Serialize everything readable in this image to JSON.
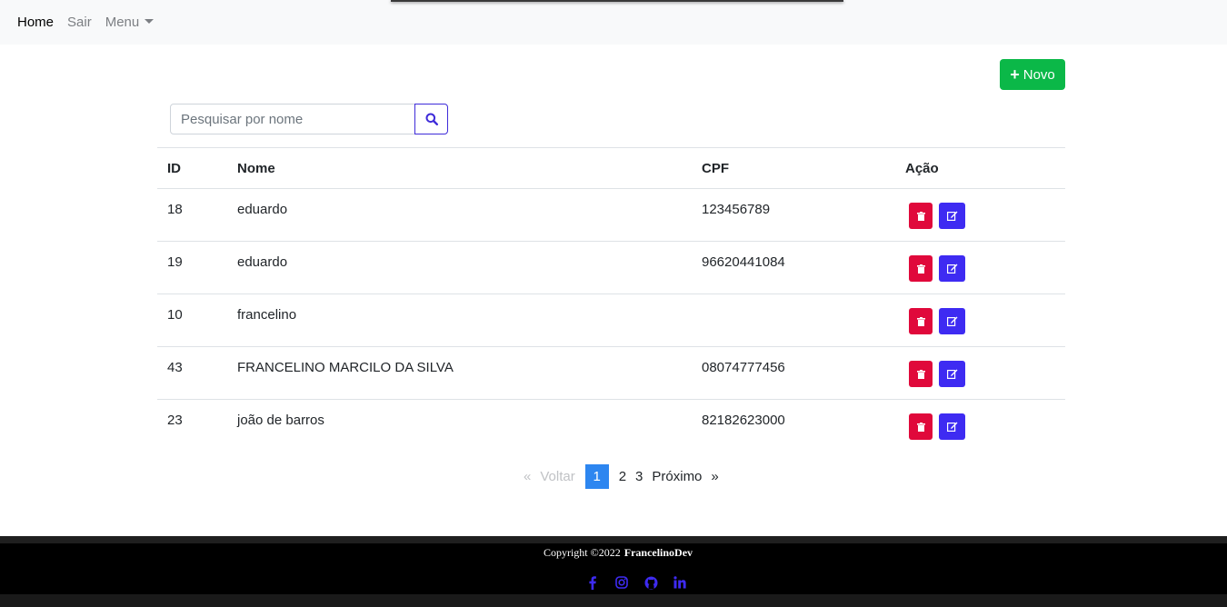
{
  "nav": {
    "home": "Home",
    "logout": "Sair",
    "menu": "Menu"
  },
  "actions": {
    "new_label": "Novo"
  },
  "search": {
    "placeholder": "Pesquisar por nome"
  },
  "table": {
    "headers": [
      "ID",
      "Nome",
      "CPF",
      "Ação"
    ],
    "rows": [
      {
        "id": "18",
        "nome": "eduardo",
        "cpf": "123456789"
      },
      {
        "id": "19",
        "nome": "eduardo",
        "cpf": "96620441084"
      },
      {
        "id": "10",
        "nome": "francelino",
        "cpf": ""
      },
      {
        "id": "43",
        "nome": "FRANCELINO MARCILO DA SILVA",
        "cpf": "08074777456"
      },
      {
        "id": "23",
        "nome": "joão de barros",
        "cpf": "82182623000"
      }
    ]
  },
  "pagination": {
    "prev_arrow": "«",
    "prev": "Voltar",
    "pages": [
      "1",
      "2",
      "3"
    ],
    "current": "1",
    "next": "Próximo",
    "next_arrow": "»"
  },
  "footer": {
    "copyright": "Copyright  ©2022",
    "brand": "FrancelinoDev",
    "social_icons": [
      "facebook-icon",
      "instagram-icon",
      "github-icon",
      "linkedin-icon"
    ]
  },
  "colors": {
    "new_button": "#0bb848",
    "delete_button": "#e0093b",
    "edit_button": "#3e2bf2",
    "active_page": "#2d86f0",
    "social_icon": "#3e2bf2"
  }
}
